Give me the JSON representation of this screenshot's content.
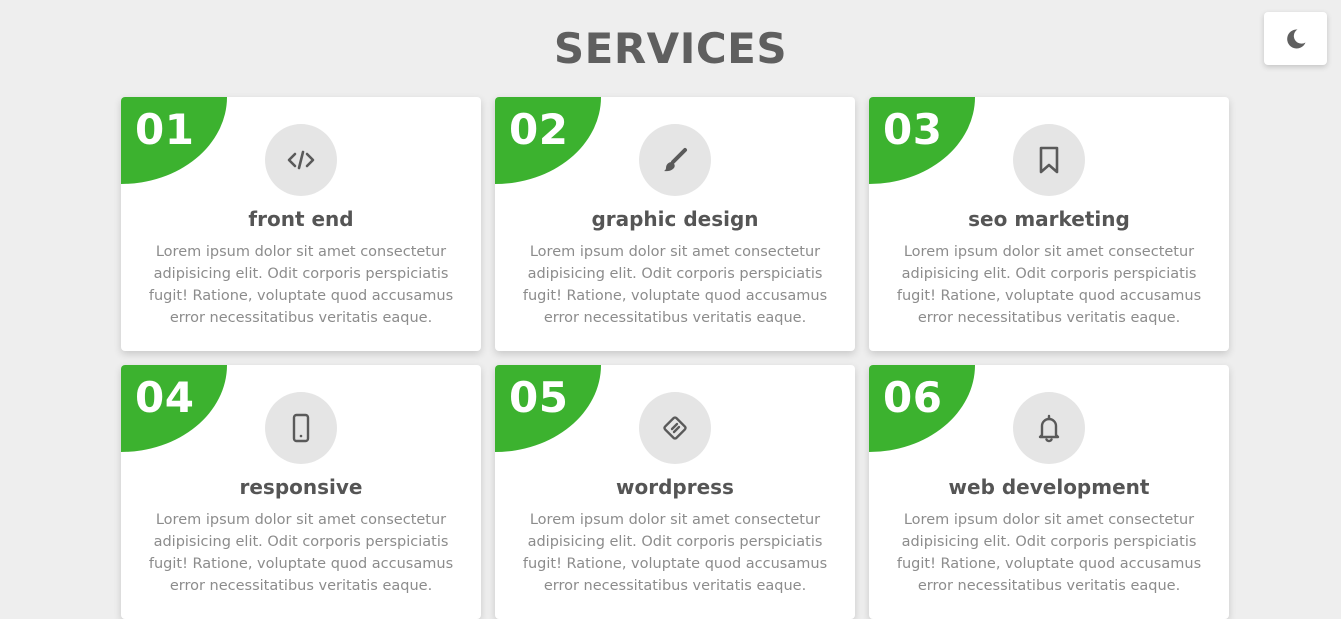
{
  "page": {
    "title": "SERVICES"
  },
  "theme_toggle": {
    "icon": "moon-icon"
  },
  "colors": {
    "accent": "#3cb22f",
    "background": "#eeeeee",
    "icon_circle": "#e5e5e5",
    "title_text": "#5f5f5f",
    "body_text": "#8c8c8c"
  },
  "services": [
    {
      "number": "01",
      "icon": "code-icon",
      "title": "front end",
      "description": "Lorem ipsum dolor sit amet consectetur adipisicing elit. Odit corporis perspiciatis fugit! Ratione, voluptate quod accusamus error necessitatibus veritatis eaque."
    },
    {
      "number": "02",
      "icon": "paint-brush-icon",
      "title": "graphic design",
      "description": "Lorem ipsum dolor sit amet consectetur adipisicing elit. Odit corporis perspiciatis fugit! Ratione, voluptate quod accusamus error necessitatibus veritatis eaque."
    },
    {
      "number": "03",
      "icon": "bookmark-icon",
      "title": "seo marketing",
      "description": "Lorem ipsum dolor sit amet consectetur adipisicing elit. Odit corporis perspiciatis fugit! Ratione, voluptate quod accusamus error necessitatibus veritatis eaque."
    },
    {
      "number": "04",
      "icon": "mobile-icon",
      "title": "responsive",
      "description": "Lorem ipsum dolor sit amet consectetur adipisicing elit. Odit corporis perspiciatis fugit! Ratione, voluptate quod accusamus error necessitatibus veritatis eaque."
    },
    {
      "number": "05",
      "icon": "wordpress-icon",
      "title": "wordpress",
      "description": "Lorem ipsum dolor sit amet consectetur adipisicing elit. Odit corporis perspiciatis fugit! Ratione, voluptate quod accusamus error necessitatibus veritatis eaque."
    },
    {
      "number": "06",
      "icon": "bell-icon",
      "title": "web development",
      "description": "Lorem ipsum dolor sit amet consectetur adipisicing elit. Odit corporis perspiciatis fugit! Ratione, voluptate quod accusamus error necessitatibus veritatis eaque."
    }
  ]
}
